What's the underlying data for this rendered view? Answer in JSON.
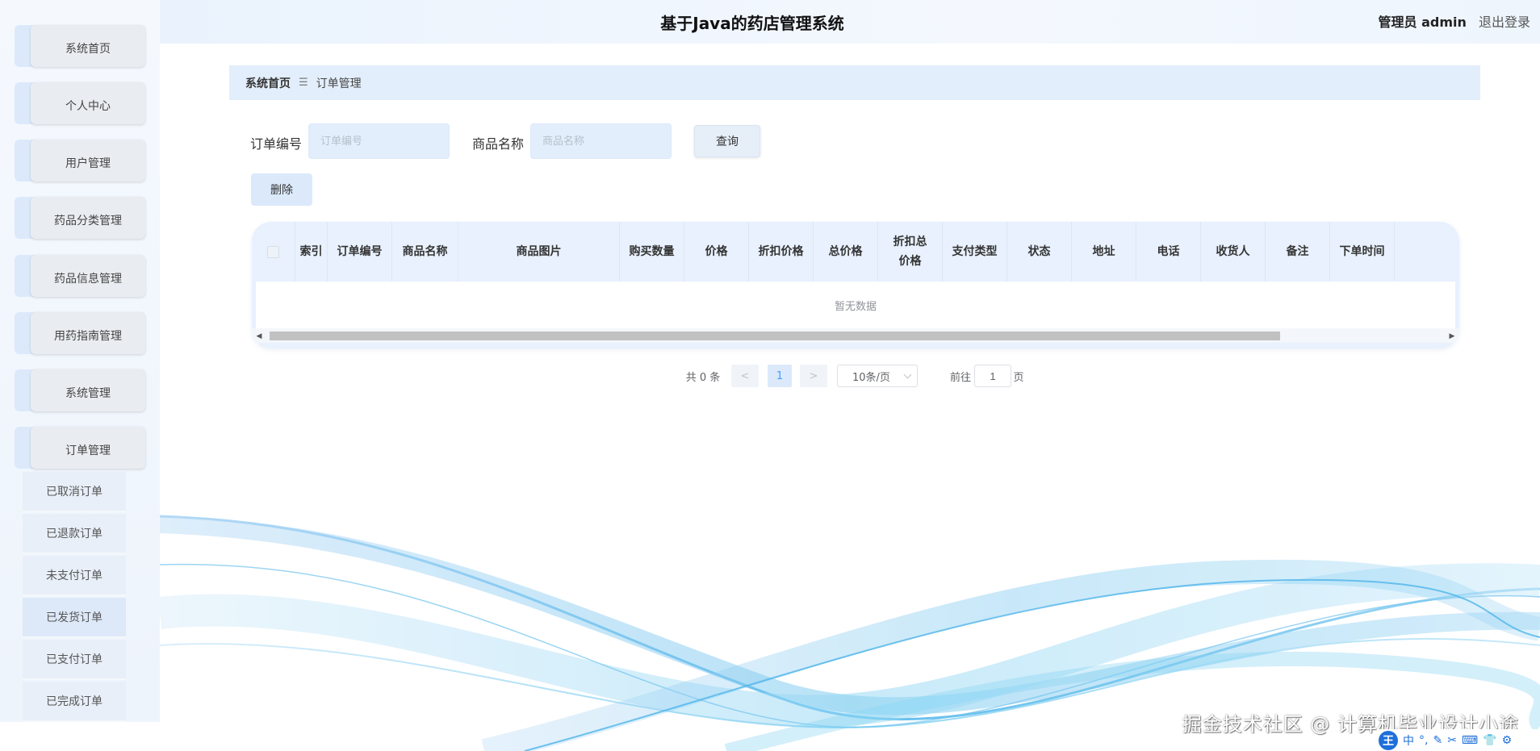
{
  "header": {
    "title": "基于Java的药店管理系统",
    "user_label": "管理员 admin",
    "logout": "退出登录"
  },
  "sidebar": {
    "items": [
      {
        "label": "系统首页"
      },
      {
        "label": "个人中心"
      },
      {
        "label": "用户管理"
      },
      {
        "label": "药品分类管理"
      },
      {
        "label": "药品信息管理"
      },
      {
        "label": "用药指南管理"
      },
      {
        "label": "系统管理"
      },
      {
        "label": "订单管理"
      }
    ],
    "submenu": [
      {
        "label": "已取消订单"
      },
      {
        "label": "已退款订单"
      },
      {
        "label": "未支付订单"
      },
      {
        "label": "已发货订单",
        "active": true
      },
      {
        "label": "已支付订单"
      },
      {
        "label": "已完成订单"
      }
    ]
  },
  "breadcrumb": {
    "home": "系统首页",
    "separator": "☰",
    "current": "订单管理"
  },
  "search": {
    "order_no_label": "订单编号",
    "order_no_placeholder": "订单编号",
    "order_no_value": "",
    "product_label": "商品名称",
    "product_placeholder": "商品名称",
    "product_value": "",
    "query_button": "查询",
    "delete_button": "删除"
  },
  "table": {
    "columns": [
      "索引",
      "订单编号",
      "商品名称",
      "商品图片",
      "购买数量",
      "价格",
      "折扣价格",
      "总价格",
      "折扣总价格",
      "支付类型",
      "状态",
      "地址",
      "电话",
      "收货人",
      "备注",
      "下单时间"
    ],
    "rows": [],
    "empty_text": "暂无数据"
  },
  "pagination": {
    "total_text": "共 0 条",
    "prev": "<",
    "current_page": "1",
    "next": ">",
    "page_size": "10条/页",
    "goto_label": "前往",
    "goto_value": "1",
    "page_suffix": "页"
  },
  "watermark": "掘金技术社区 @ 计算机毕业设计小途",
  "ime": {
    "logo": "王",
    "mode": "中",
    "icons": [
      "punctuation-icon",
      "pen-icon",
      "scissors-icon",
      "keyboard-icon",
      "shirt-icon",
      "settings-icon"
    ]
  },
  "colors": {
    "accent": "#409eff",
    "header_bg": "#eaf3fd",
    "breadcrumb_bg": "#e3eefc",
    "sidebar_item_bg": "#dbe9fb"
  }
}
